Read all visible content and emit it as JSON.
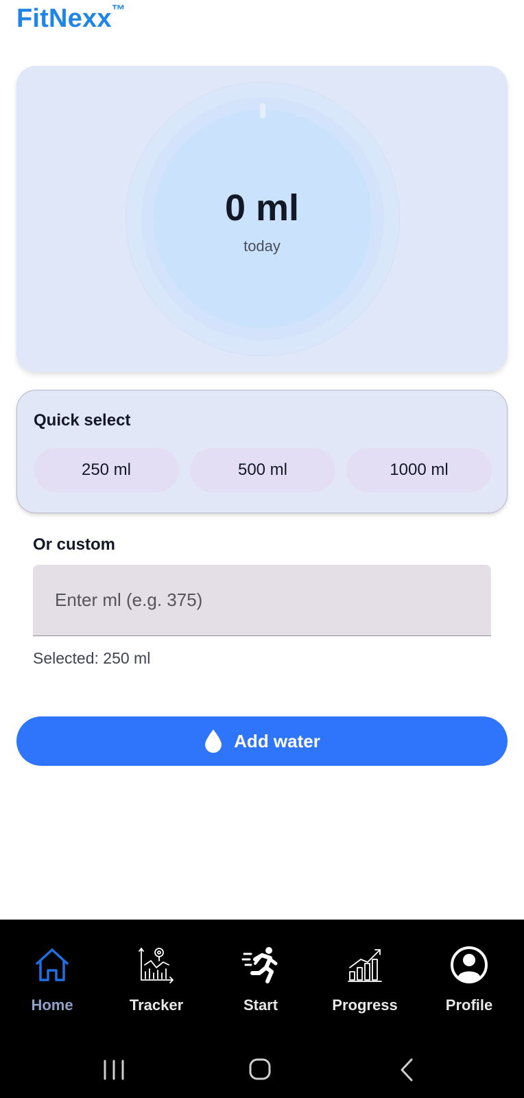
{
  "app": {
    "brand": "FitNexx",
    "brand_mark": "™"
  },
  "intake": {
    "amount": "0 ml",
    "period": "today",
    "progress_fraction": 0
  },
  "quick_select": {
    "title": "Quick select",
    "options": [
      "250 ml",
      "500 ml",
      "1000 ml"
    ]
  },
  "custom": {
    "title": "Or custom",
    "placeholder": "Enter ml (e.g. 375)",
    "value": "",
    "selected_text": "Selected: 250 ml"
  },
  "actions": {
    "add_label": "Add water",
    "add_icon": "water-drop-icon"
  },
  "nav": {
    "items": [
      {
        "label": "Home",
        "icon": "home-icon",
        "active": true
      },
      {
        "label": "Tracker",
        "icon": "tracker-chart-icon",
        "active": false
      },
      {
        "label": "Start",
        "icon": "running-person-icon",
        "active": false
      },
      {
        "label": "Progress",
        "icon": "bar-chart-icon",
        "active": false
      },
      {
        "label": "Profile",
        "icon": "profile-icon",
        "active": false
      }
    ]
  },
  "system_nav": {
    "recents_icon": "recents-icon",
    "home_icon": "system-home-icon",
    "back_icon": "back-icon"
  },
  "colors": {
    "brand": "#1f86e8",
    "primary_button": "#2f75fb",
    "active_nav": "#1f6fe0",
    "chip_bg": "#e4def5",
    "card_bg": "#dfe7f9"
  }
}
